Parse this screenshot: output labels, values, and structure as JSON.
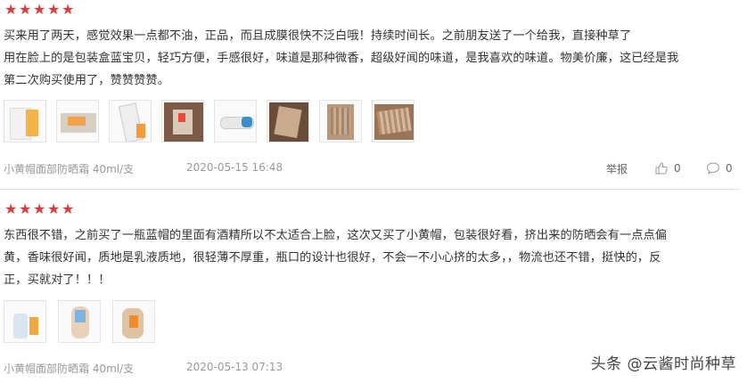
{
  "reviews": [
    {
      "stars": 5,
      "text_lines": [
        "买来用了两天，感觉效果一点都不油，正品，而且成膜很快不泛白哦！持续时间长。之前朋友送了一个给我，直接种草了",
        "用在脸上的是包装盒蓝宝贝，轻巧方便，手感很好，味道是那种微香，超级好闻的味道，是我喜欢的味道。物美价廉，这已经是我",
        "第二次购买使用了，赞赞赞赞。"
      ],
      "photo_count": 8,
      "product": "小黄帽面部防晒霜 40ml/支",
      "date": "2020-05-15 16:48",
      "report_label": "举报",
      "likes": "0",
      "replies": "0"
    },
    {
      "stars": 5,
      "text_lines": [
        "东西很不错，之前买了一瓶蓝帽的里面有酒精所以不太适合上脸，这次又买了小黄帽，包装很好看，挤出来的防晒会有一点点偏",
        "黄，香味很好闻，质地是乳液质地，很轻薄不厚重，瓶口的设计也很好，不会一不小心挤的太多，，物流也还不错，挺快的，反",
        "正，买就对了！！！"
      ],
      "photo_count": 3,
      "product": "小黄帽面部防晒霜 40ml/支",
      "date": "2020-05-13 07:13"
    }
  ],
  "icons": {
    "star": "star-icon",
    "like": "thumb-up-icon",
    "reply": "speech-bubble-icon"
  },
  "watermark": "头条 @云酱时尚种草",
  "colors": {
    "star": "#e4393c",
    "meta_text": "#999999",
    "divider": "#e0e0e0"
  }
}
